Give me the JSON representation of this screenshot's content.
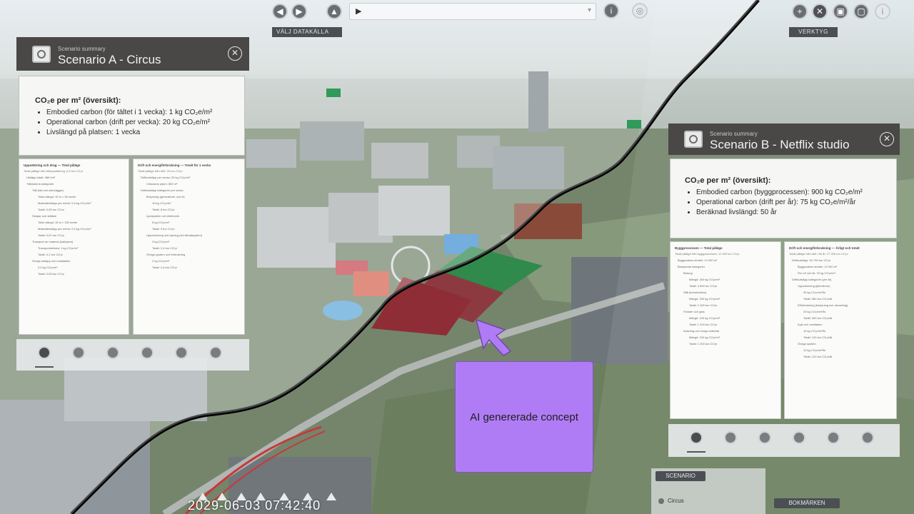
{
  "toolbar": {
    "datasource_label": "VÄLJ DATAKÄLLA",
    "tools_label": "VERKTYG",
    "play_glyph": "▶",
    "dropdown_glyph": "▾",
    "info_glyph": "i",
    "plus_glyph": "+"
  },
  "panel_a": {
    "subtitle": "Scenario summary",
    "title": "Scenario A - Circus",
    "close_glyph": "✕",
    "summary": {
      "heading": "CO₂e per m² (översikt):",
      "lines": [
        "Embodied carbon (för tältet i 1 vecka): 1 kg CO₂e/m²",
        "Operational carbon (drift per vecka): 20 kg CO₂e/m²",
        "Livslängd på platsen: 1 vecka"
      ]
    },
    "detail_left": {
      "heading": "Uppsättning och drag — Total påläge",
      "sub": "Totalt påläge från tältuppsättning: 0,8 ton CO₂e",
      "items": [
        "Utsläpp totalt: 380 t/m²",
        "Tältdukens kategorier",
        "Tält (tak och sidoväggar)",
        "Total mängd: 15 m × 50 meter",
        "Materialinsläpp per enhet: 0,6 kg CO₂e/m²",
        "Totalt: 0,05 ton CO₂e",
        "Stolpar och ställare",
        "Total mängd: 15 st × 150 meter",
        "Materialinsläpp per enhet: 0,5 kg CO₂e/m²",
        "Totalt: 0,01 ton CO₂e",
        "Transport av material (kalkylera)",
        "Transportsträcka: 1 kg CO₂e/m²",
        "Totalt: 0,1 ton CO₂e",
        "Övriga utsläpp och installation",
        "2,0 kg CO₂e/m²",
        "Totalt: 0,05 ton CO₂e"
      ]
    },
    "detail_right": {
      "heading": "Drift och energiförbrukning — Totalt för 1 vecka",
      "sub": "Totalt påläge från drift: 20 ton CO₂e",
      "items": [
        "Driftsutsläpp per vecka: 20 kg CO₂e/m²",
        "Cirkusens yta/m: 800 m²",
        "Driftsutsläpp kategorier per vecka",
        "Belysning (generatorer och el)",
        "10 kg CO₂e/m²",
        "Totalt: 8 ton CO₂e",
        "Ljudsystem och elektronik",
        "5 kg CO₂e/m²",
        "Totalt: 3 ton CO₂e",
        "Uppvärmning och kylning (vid klimatsystem)",
        "3 kg CO₂e/m²",
        "Totalt: 2,4 ton CO₂e",
        "Övriga system och förbrukning",
        "2 kg CO₂e/m²",
        "Totalt: 1,6 ton CO₂e"
      ]
    }
  },
  "panel_b": {
    "subtitle": "Scenario summary",
    "title": "Scenario B - Netflix studio",
    "close_glyph": "✕",
    "summary": {
      "heading": "CO₂e per m² (översikt):",
      "lines": [
        "Embodied carbon (byggprocessen): 900 kg CO₂e/m²",
        "Operational carbon (drift per år): 75 kg CO₂e/m²/år",
        "Beräknad livslängd: 50 år"
      ]
    },
    "detail_left": {
      "heading": "Byggprocessen — Total påläge",
      "sub": "Totalt påläge från byggprocessen: 11 000 ton CO₂e",
      "items": [
        "Byggnadens storlek: 12 000 m²",
        "Betydande kategorier",
        "Betong",
        "Mängd: 400 kg CO₂e/m²",
        "Totalt: 4 800 ton CO₂e",
        "Stål (konstruktion)",
        "Mängd: 200 kg CO₂e/m²",
        "Totalt: 2 400 ton CO₂e",
        "Fönster och glas",
        "Mängd: 100 kg CO₂e/m²",
        "Totalt: 1 200 ton CO₂e",
        "Isolering och övriga material",
        "Mängd: 100 kg CO₂e/m²",
        "Totalt: 1 200 ton CO₂e"
      ]
    },
    "detail_right": {
      "heading": "Drift och energiförbrukning — Årligt och totalt",
      "sub": "Totalt påläge från drift i 50 år: 27 000 ton CO₂e",
      "items": [
        "Driftsutsläpp: 54 700 ton CO₂e",
        "Byggnadens storlek: 12 000 m²",
        "Per m² och år: 75 kg CO₂e/m²",
        "Driftsutsläpp kategorier (per år)",
        "Uppvärmning (fjärrvärme)",
        "30 kg CO₂e/m²/år",
        "Totalt: 360 ton CO₂e/år",
        "Elförbrukning (belysning och utrustning)",
        "25 kg CO₂e/m²/år",
        "Totalt: 300 ton CO₂e/år",
        "Kyla och ventilation",
        "10 kg CO₂e/m²/år",
        "Totalt: 120 ton CO₂e/år",
        "Övriga system",
        "10 kg CO₂e/m²/år",
        "Totalt: 120 ton CO₂e/år"
      ]
    }
  },
  "annotation": {
    "text": "AI genererade concept",
    "color": "#b07cf5"
  },
  "timeline": {
    "timestamp": "2029-06-03 07:42:40"
  },
  "scenario_panel": {
    "label": "SCENARIO",
    "item": "Circus"
  },
  "bookmarks_label": "BOKMÄRKEN",
  "icons": {
    "toolbar": [
      "back-icon",
      "forward-icon",
      "up-icon",
      "info-icon",
      "globe-icon",
      "zoom-in-icon",
      "target-icon",
      "layers-icon",
      "settings-icon"
    ],
    "panel_footer": [
      "info-icon",
      "measure-icon",
      "compare-icon",
      "list-icon",
      "settings-icon",
      "share-icon"
    ]
  }
}
